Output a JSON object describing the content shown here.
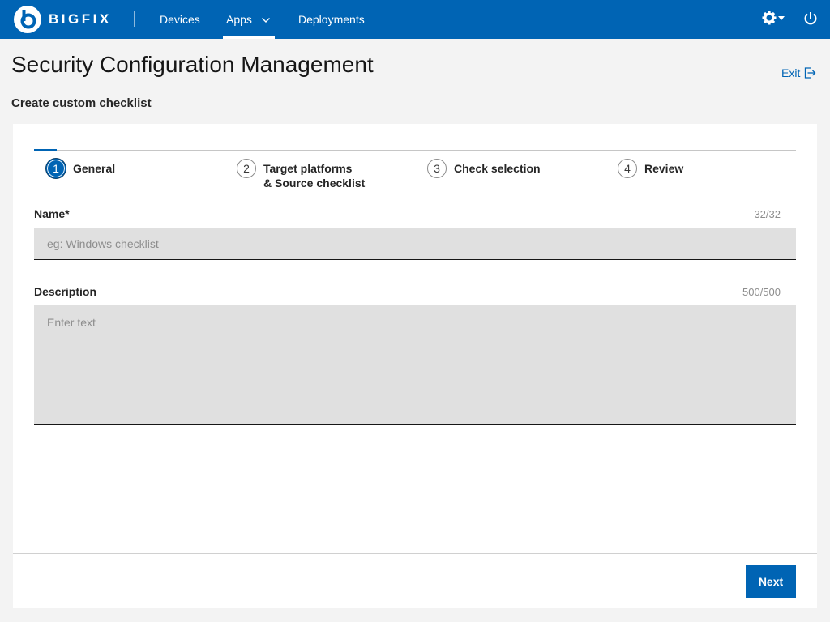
{
  "brand": {
    "name": "BIGFIX",
    "color": "#0064b4"
  },
  "nav": {
    "items": [
      {
        "label": "Devices",
        "active": false
      },
      {
        "label": "Apps",
        "active": true,
        "has_dropdown": true
      },
      {
        "label": "Deployments",
        "active": false
      }
    ],
    "settings_icon": "gear-icon",
    "power_icon": "power-icon"
  },
  "header": {
    "title": "Security Configuration Management",
    "exit_label": "Exit",
    "subtitle": "Create custom checklist"
  },
  "wizard": {
    "steps": [
      {
        "number": "1",
        "label_line1": "General",
        "label_line2": "",
        "active": true
      },
      {
        "number": "2",
        "label_line1": "Target platforms",
        "label_line2": "& Source checklist",
        "active": false
      },
      {
        "number": "3",
        "label_line1": "Check selection",
        "label_line2": "",
        "active": false
      },
      {
        "number": "4",
        "label_line1": "Review",
        "label_line2": "",
        "active": false
      }
    ]
  },
  "form": {
    "name": {
      "label": "Name*",
      "counter": "32/32",
      "value": "",
      "placeholder": "eg: Windows checklist"
    },
    "description": {
      "label": "Description",
      "counter": "500/500",
      "value": "",
      "placeholder": "Enter text"
    }
  },
  "footer": {
    "next_label": "Next"
  }
}
